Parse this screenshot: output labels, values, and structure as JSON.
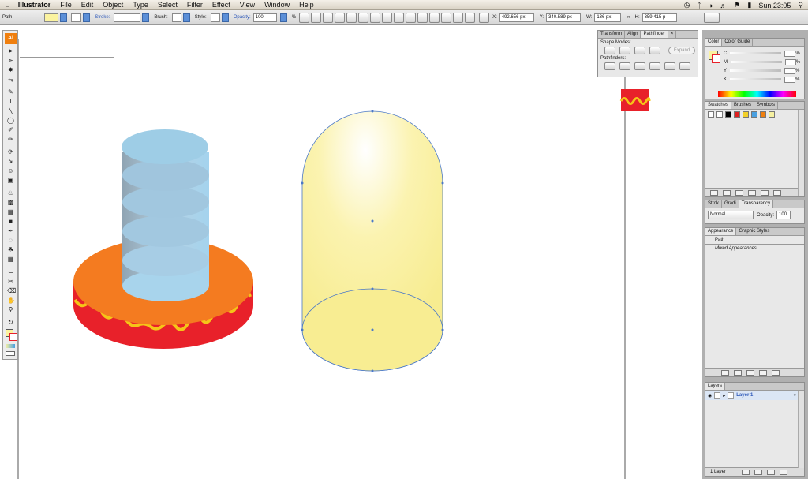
{
  "menubar": {
    "app": "Illustrator",
    "items": [
      "File",
      "Edit",
      "Object",
      "Type",
      "Select",
      "Filter",
      "Effect",
      "View",
      "Window",
      "Help"
    ],
    "clock": "Sun 23:05"
  },
  "control": {
    "selection": "Path",
    "stroke_label": "Stroke:",
    "brush_label": "Brush:",
    "style_label": "Style:",
    "opacity_label": "Opacity:",
    "opacity_value": "100",
    "opacity_unit": "%",
    "x_label": "X:",
    "x_value": "492.656 px",
    "y_label": "Y:",
    "y_value": "340.589 px",
    "w_label": "W:",
    "w_value": "136 px",
    "h_label": "H:",
    "h_value": "359.415 p"
  },
  "toolbox": {
    "logo": "Ai"
  },
  "pathfinder": {
    "tabs": [
      "Transform",
      "Align",
      "Pathfinder"
    ],
    "shape_modes": "Shape Modes:",
    "expand": "Expand",
    "pathfinders": "Pathfinders:"
  },
  "color_panel": {
    "tabs": [
      "Color",
      "Color Guide"
    ],
    "channels": [
      "C",
      "M",
      "Y",
      "K"
    ],
    "pct": "%"
  },
  "swatches_panel": {
    "tabs": [
      "Swatches",
      "Brushes",
      "Symbols"
    ],
    "swatches": [
      "#ffffff",
      "#000000",
      "#e02020",
      "#f2d02a",
      "#4aa0e0",
      "#f07f0e",
      "#f5f0a0"
    ]
  },
  "transparency_panel": {
    "tabs": [
      "Strok",
      "Gradi",
      "Transparency"
    ],
    "mode": "Normal",
    "opacity_label": "Opacity:",
    "opacity_value": "100"
  },
  "appearance_panel": {
    "tabs": [
      "Appearance",
      "Graphic Styles"
    ],
    "path": "Path",
    "mixed": "Mixed Appearances"
  },
  "layers_panel": {
    "tabs": [
      "Layers"
    ],
    "layer": "Layer 1",
    "count": "1 Layer"
  },
  "colors": {
    "orange": "#f47b20",
    "red": "#e8212a",
    "yellow_wave": "#f5c518",
    "blue": "#9ecde6",
    "bulb": "#fbf3a0",
    "selection": "#4a78c8"
  }
}
